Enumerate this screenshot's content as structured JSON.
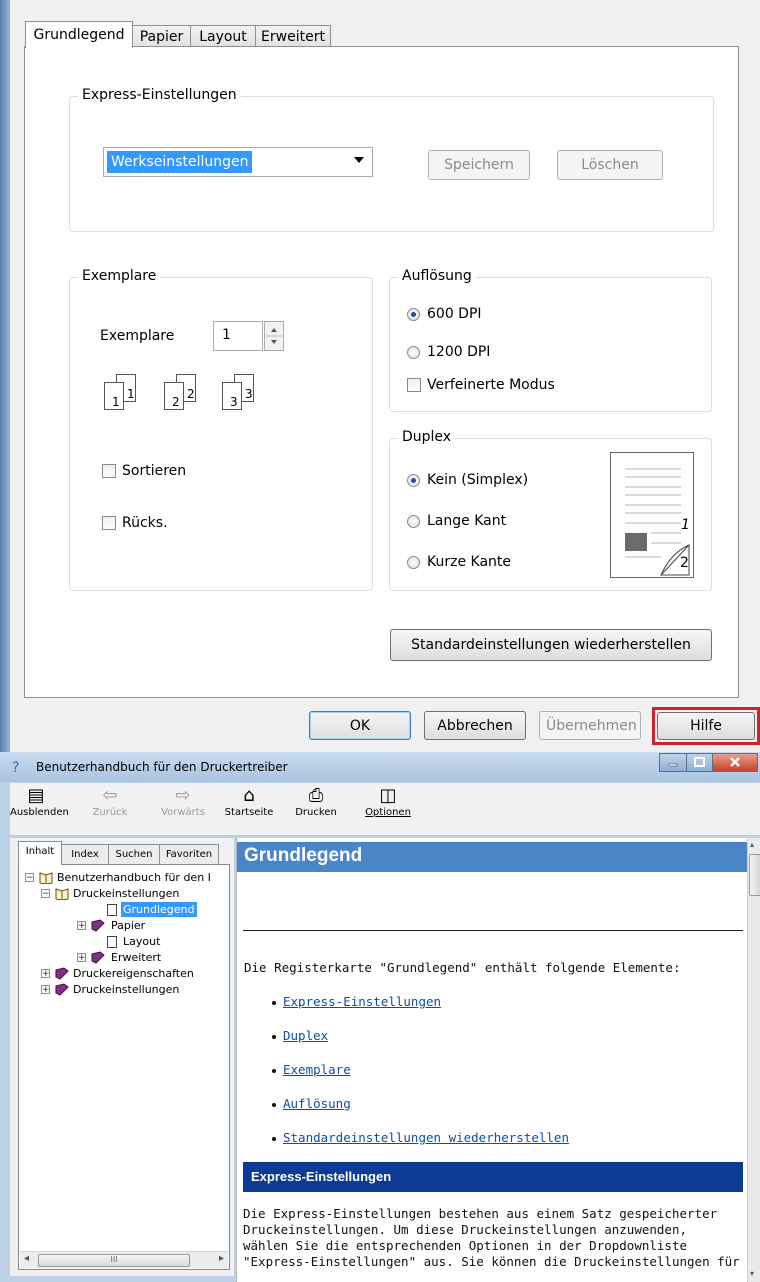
{
  "dialog": {
    "tabs": [
      "Grundlegend",
      "Papier",
      "Layout",
      "Erweitert"
    ],
    "express": {
      "title": "Express-Einstellungen",
      "selected": "Werkseinstellungen",
      "save": "Speichern",
      "delete": "Löschen"
    },
    "copies": {
      "title": "Exemplare",
      "label": "Exemplare",
      "value": "1",
      "collate": "Sortieren",
      "reverse": "Rücks.",
      "icon_numbers": [
        "1",
        "1",
        "2",
        "2",
        "3",
        "3"
      ]
    },
    "resolution": {
      "title": "Auflösung",
      "options": [
        "600 DPI",
        "1200 DPI"
      ],
      "selected": "600 DPI",
      "refined": "Verfeinerte Modus"
    },
    "duplex": {
      "title": "Duplex",
      "options": [
        "Kein (Simplex)",
        "Lange Kant",
        "Kurze Kante"
      ],
      "selected": "Kein (Simplex)",
      "preview_numbers": [
        "1",
        "2"
      ]
    },
    "restore_defaults": "Standardeinstellungen wiederherstellen",
    "buttons": {
      "ok": "OK",
      "cancel": "Abbrechen",
      "apply": "Übernehmen",
      "help": "Hilfe"
    },
    "colors": {
      "help_highlight": "#d0202a",
      "selection": "#3399ff"
    }
  },
  "help": {
    "title": "Benutzerhandbuch für den Druckertreiber",
    "toolbar": [
      "Ausblenden",
      "Zurück",
      "Vorwärts",
      "Startseite",
      "Drucken",
      "Optionen"
    ],
    "nav_tabs": [
      "Inhalt",
      "Index",
      "Suchen",
      "Favoriten"
    ],
    "tree": [
      "Benutzerhandbuch für den I",
      "Druckeinstellungen",
      "Grundlegend",
      "Papier",
      "Layout",
      "Erweitert",
      "Druckereigenschaften",
      "Druckeinstellungen"
    ],
    "scroll_grip": "III",
    "content": {
      "heading": "Grundlegend",
      "intro": "Die Registerkarte \"Grundlegend\" enthält folgende Elemente:",
      "links": [
        "Express-Einstellungen",
        "Duplex",
        "Exemplare",
        "Auflösung",
        "Standardeinstellungen wiederherstellen"
      ],
      "section_title": "Express-Einstellungen",
      "paragraph": [
        "Die Express-Einstellungen bestehen aus einem Satz gespeicherter",
        "Druckeinstellungen. Um diese Druckeinstellungen anzuwenden,",
        "wählen Sie die entsprechenden Optionen in der Dropdownliste",
        "\"Express-Einstellungen\" aus. Sie können die Druckeinstellungen für"
      ]
    },
    "colors": {
      "heading_bar": "#4a86c7",
      "section_bar": "#0b3b94",
      "link": "#0b4fa6"
    }
  }
}
